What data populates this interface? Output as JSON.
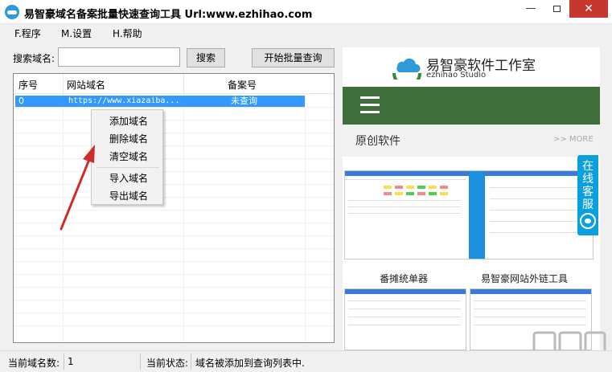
{
  "window": {
    "title": "易智豪域名备案批量快速查询工具 Url:www.ezhihao.com",
    "minimize": "—",
    "close": "✕"
  },
  "menu": {
    "items": [
      "F.程序",
      "M.设置",
      "H.帮助"
    ]
  },
  "toolbar": {
    "search_label": "搜索域名:",
    "search_value": "",
    "search_button": "搜索",
    "batch_button": "开始批量查询"
  },
  "table": {
    "headers": [
      "序号",
      "网站域名",
      "备案号"
    ],
    "rows": [
      {
        "index": "0",
        "domain": "https://www.xiazaiba...",
        "record": "未查询"
      }
    ]
  },
  "context_menu": {
    "items": [
      "添加域名",
      "删除域名",
      "清空域名",
      "导入域名",
      "导出域名"
    ]
  },
  "status": {
    "count_label": "当前域名数:",
    "count_value": "1",
    "state_label": "当前状态:",
    "state_value": "域名被添加到查询列表中."
  },
  "web": {
    "logo_title": "易智豪软件工作室",
    "logo_subtitle": "ezhihao Studio",
    "section_title": "原创软件",
    "section_more": ">> MORE",
    "caption_1": "番摊统单器",
    "caption_2": "易智豪网站外链工具",
    "chat_label": "在线客服",
    "brand_green": "#3f6e3a",
    "chat_blue": "#0aa0df"
  },
  "colors": {
    "selection": "#3399ff",
    "arrow": "#d02a2a",
    "close": "#c7372f"
  }
}
